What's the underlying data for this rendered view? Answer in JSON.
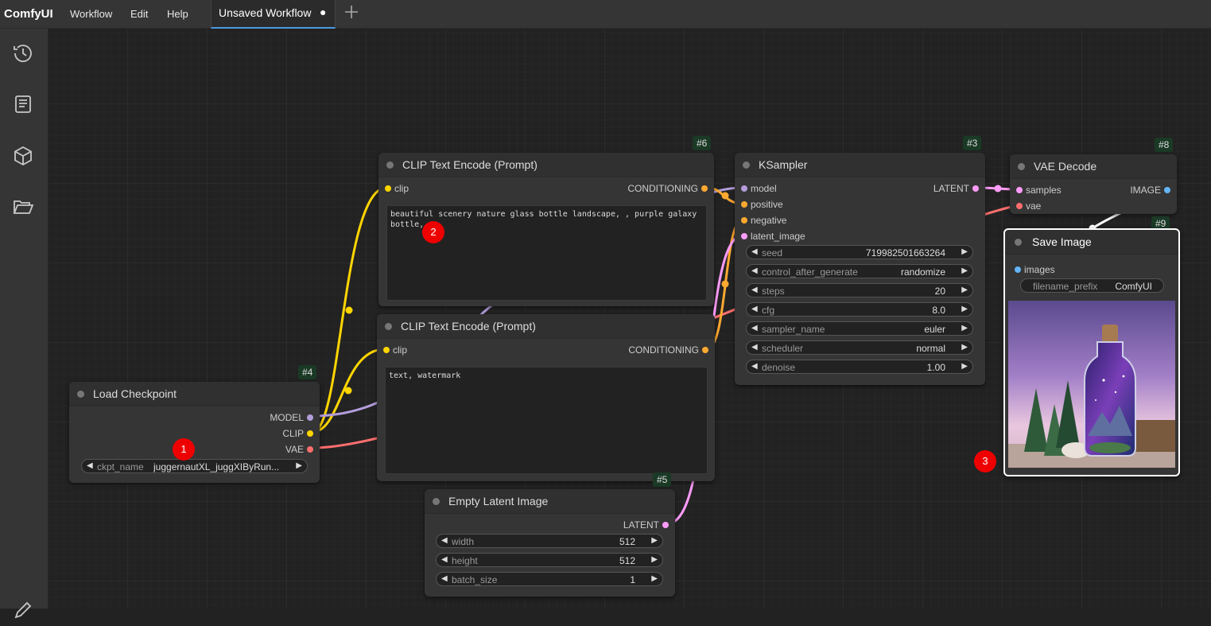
{
  "app": {
    "logo": "ComfyUI"
  },
  "menu": [
    {
      "label": "Workflow"
    },
    {
      "label": "Edit"
    },
    {
      "label": "Help"
    }
  ],
  "tab": {
    "label": "Unsaved Workflow",
    "modified_indicator": "●"
  },
  "sidebar": {
    "icons": [
      "history-icon",
      "book-icon",
      "cube-icon",
      "folder-open-icon"
    ]
  },
  "colors": {
    "model": "#b39ddb",
    "clip": "#ffd500",
    "vae": "#ff6e6e",
    "conditioning": "#ffa931",
    "latent": "#ff9cf9",
    "image": "#64b5f6"
  },
  "nodes": {
    "load_checkpoint": {
      "id": "#4",
      "title": "Load Checkpoint",
      "outputs": [
        "MODEL",
        "CLIP",
        "VAE"
      ],
      "ckpt_name": {
        "name": "ckpt_name",
        "value": "juggernautXL_juggXIByRun..."
      }
    },
    "clip_pos": {
      "id": "#6",
      "title": "CLIP Text Encode (Prompt)",
      "input": "clip",
      "output": "CONDITIONING",
      "text": "beautiful scenery nature glass bottle landscape, , purple galaxy bottle,"
    },
    "clip_neg": {
      "id": "#7",
      "title": "CLIP Text Encode (Prompt)",
      "input": "clip",
      "output": "CONDITIONING",
      "text": "text, watermark"
    },
    "ksampler": {
      "id": "#3",
      "title": "KSampler",
      "inputs": [
        "model",
        "positive",
        "negative",
        "latent_image"
      ],
      "output": "LATENT",
      "widgets": [
        {
          "name": "seed",
          "value": "719982501663264"
        },
        {
          "name": "control_after_generate",
          "value": "randomize"
        },
        {
          "name": "steps",
          "value": "20"
        },
        {
          "name": "cfg",
          "value": "8.0"
        },
        {
          "name": "sampler_name",
          "value": "euler"
        },
        {
          "name": "scheduler",
          "value": "normal"
        },
        {
          "name": "denoise",
          "value": "1.00"
        }
      ]
    },
    "vae_decode": {
      "id": "#8",
      "title": "VAE Decode",
      "inputs": [
        "samples",
        "vae"
      ],
      "output": "IMAGE"
    },
    "save_image": {
      "id": "#9",
      "title": "Save Image",
      "input": "images",
      "filename_prefix": {
        "name": "filename_prefix",
        "value": "ComfyUI"
      }
    },
    "empty_latent": {
      "id": "#5",
      "title": "Empty Latent Image",
      "output": "LATENT",
      "widgets": [
        {
          "name": "width",
          "value": "512"
        },
        {
          "name": "height",
          "value": "512"
        },
        {
          "name": "batch_size",
          "value": "1"
        }
      ]
    }
  },
  "badges": [
    "1",
    "2",
    "3"
  ]
}
